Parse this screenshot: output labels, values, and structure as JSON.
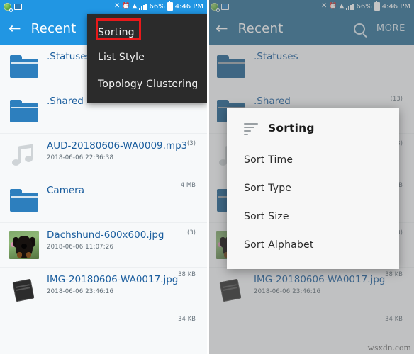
{
  "status_bar": {
    "left_icons": [
      "globe-search-icon",
      "screenshot-icon"
    ],
    "mute_icon": "✕",
    "alarm_icon": "⏰",
    "wifi_icon": "▲",
    "battery_percent": "66%",
    "time": "4:46 PM"
  },
  "panels": {
    "left": {
      "appbar": {
        "back": "←",
        "title": "Recent"
      },
      "popup_menu": {
        "items": [
          {
            "label": "Sorting",
            "highlighted": true
          },
          {
            "label": "List Style",
            "highlighted": false
          },
          {
            "label": "Topology Clustering",
            "highlighted": false
          }
        ]
      },
      "files": [
        {
          "icon": "folder-icon",
          "name": ".Statuses",
          "date": "",
          "size": "",
          "count": ""
        },
        {
          "icon": "folder-icon",
          "name": ".Shared",
          "date": "",
          "size": "",
          "count": "(3)"
        },
        {
          "icon": "music-icon",
          "name": "AUD-20180606-WA0009.mp3",
          "date": "2018-06-06 22:36:38",
          "size": "4 MB",
          "count": ""
        },
        {
          "icon": "folder-icon",
          "name": "Camera",
          "date": "",
          "size": "",
          "count": "(3)"
        },
        {
          "icon": "photo-icon",
          "name": "Dachshund-600x600.jpg",
          "date": "2018-06-06 11:07:26",
          "size": "38 KB",
          "count": ""
        },
        {
          "icon": "document-photo-icon",
          "name": "IMG-20180606-WA0017.jpg",
          "date": "2018-06-06 23:46:16",
          "size": "34 KB",
          "count": ""
        }
      ]
    },
    "right": {
      "appbar": {
        "back": "←",
        "title": "Recent",
        "search": "search-icon",
        "more": "MORE"
      },
      "files": [
        {
          "icon": "folder-icon",
          "name": ".Statuses",
          "date": "",
          "size": "",
          "count": "(13)"
        },
        {
          "icon": "folder-icon",
          "name": ".Shared",
          "date": "",
          "size": "",
          "count": "(3)"
        },
        {
          "icon": "music-icon",
          "name": "AUD-20180606-WA0009.mp3",
          "date": "2018-06-06 22:36:38",
          "size": "4 MB",
          "count": ""
        },
        {
          "icon": "folder-icon",
          "name": "Camera",
          "date": "",
          "size": "",
          "count": "(3)"
        },
        {
          "icon": "photo-icon",
          "name": "Dachshund-600x600.jpg",
          "date": "2018-06-06 11:07:26",
          "size": "38 KB",
          "count": ""
        },
        {
          "icon": "document-photo-icon",
          "name": "IMG-20180606-WA0017.jpg",
          "date": "2018-06-06 23:46:16",
          "size": "34 KB",
          "count": ""
        }
      ],
      "dialog": {
        "icon": "sort-lines-icon",
        "title": "Sorting",
        "options": [
          {
            "label": "Sort Time"
          },
          {
            "label": "Sort Type"
          },
          {
            "label": "Sort Size"
          },
          {
            "label": "Sort Alphabet"
          }
        ]
      }
    }
  },
  "watermark": "wsxdn.com",
  "colors": {
    "appbar_blue": "#2196e3",
    "appbar_blue_dim": "#2d7096",
    "folder_blue": "#2d7fbe",
    "filename_blue": "#1b5e9e",
    "menu_dark": "#2b2b2b",
    "highlight_red": "#e8191a"
  }
}
